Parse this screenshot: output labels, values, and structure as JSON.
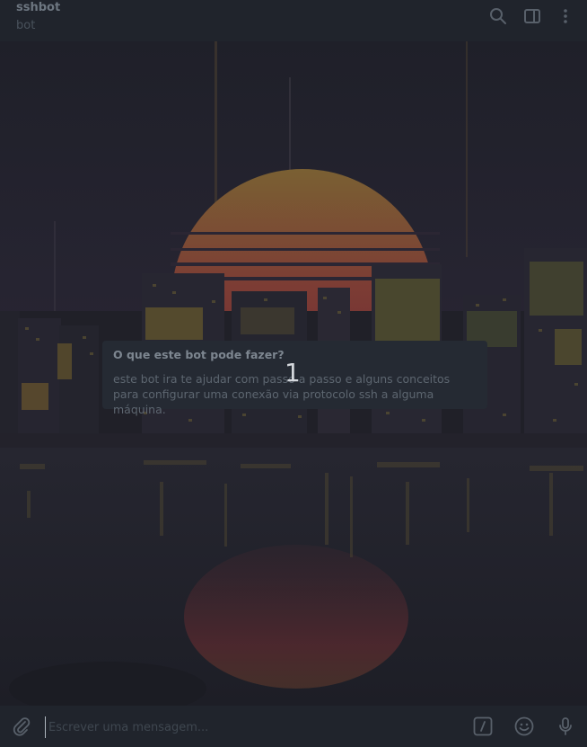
{
  "header": {
    "title": "sshbot",
    "subtitle": "bot",
    "icons": [
      "search-icon",
      "sidebar-toggle-icon",
      "more-vertical-icon"
    ]
  },
  "intro_card": {
    "title": "O que este bot pode fazer?",
    "body": "este bot ira te ajudar com passo a passo e alguns conceitos para configurar uma conexão via protocolo ssh a alguma máquina."
  },
  "overlay": {
    "number": "1"
  },
  "composer": {
    "placeholder": "Escrever uma mensagem...",
    "value": "",
    "icons": [
      "attach-icon",
      "bot-commands-icon",
      "emoji-icon",
      "microphone-icon"
    ]
  },
  "colors": {
    "header_bg": "#20242c",
    "card_bg": "#252a33",
    "sun": "#8a5a3c"
  }
}
